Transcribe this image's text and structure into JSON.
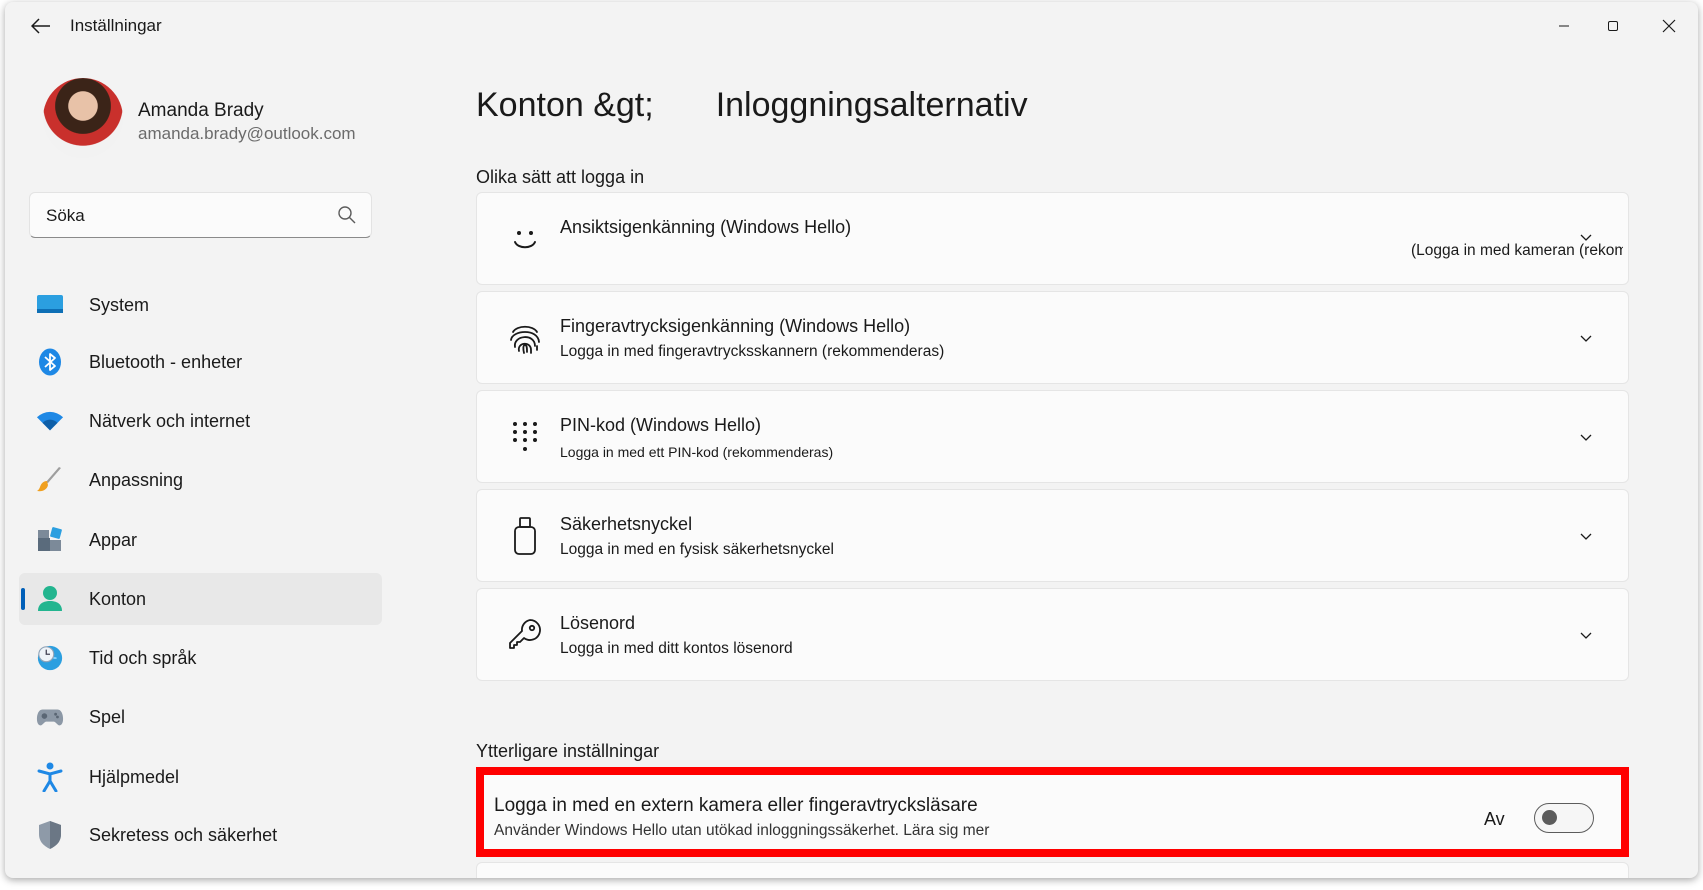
{
  "window": {
    "title": "Inställningar"
  },
  "profile": {
    "name": "Amanda Brady",
    "email": "amanda.brady@outlook.com"
  },
  "search": {
    "placeholder": "Söka"
  },
  "sidebar": {
    "items": [
      {
        "label": "System",
        "icon": "system-icon"
      },
      {
        "label": "Bluetooth - enheter",
        "icon": "bluetooth-icon"
      },
      {
        "label": "Nätverk och internet",
        "icon": "wifi-icon"
      },
      {
        "label": "Anpassning",
        "icon": "brush-icon"
      },
      {
        "label": "Appar",
        "icon": "apps-icon"
      },
      {
        "label": "Konton",
        "icon": "account-icon",
        "selected": true
      },
      {
        "label": "Tid och språk",
        "icon": "globe-clock-icon"
      },
      {
        "label": "Spel",
        "icon": "gamepad-icon"
      },
      {
        "label": "Hjälpmedel",
        "icon": "accessibility-icon"
      },
      {
        "label": "Sekretess och säkerhet",
        "icon": "shield-icon"
      }
    ]
  },
  "main": {
    "breadcrumb_parent": "Konton &gt;",
    "breadcrumb_current": "Inloggningsalternativ",
    "section_signin": "Olika sätt att logga in",
    "cards": [
      {
        "title": "Ansiktsigenkänning (Windows Hello)",
        "subtitle": "(Logga in med kameran (rekommenderas)",
        "icon": "face-icon"
      },
      {
        "title": "Fingeravtrycksigenkänning (Windows Hello)",
        "subtitle": "Logga in med fingeravtrycksskannern (rekommenderas)",
        "icon": "fingerprint-icon"
      },
      {
        "title": "PIN-kod (Windows Hello)",
        "subtitle": "Logga in med ett  PIN-kod (rekommenderas)",
        "icon": "pin-keypad-icon"
      },
      {
        "title": "Säkerhetsnyckel",
        "subtitle": "Logga in med en fysisk säkerhetsnyckel",
        "icon": "usb-key-icon"
      },
      {
        "title": "Lösenord",
        "subtitle": "Logga in med ditt kontos lösenord",
        "icon": "key-icon"
      }
    ],
    "section_additional": "Ytterligare inställningar",
    "external": {
      "title": "Logga in med en extern kamera eller fingeravtrycksläsare",
      "subtitle": "Använder Windows Hello utan utökad inloggningssäkerhet. Lära sig mer",
      "toggle_state": "Av",
      "enabled": false
    }
  },
  "colors": {
    "accent": "#005fb8",
    "highlight": "#ff0000",
    "window_bg": "#f3f3f3",
    "card_bg": "#fbfbfb"
  }
}
